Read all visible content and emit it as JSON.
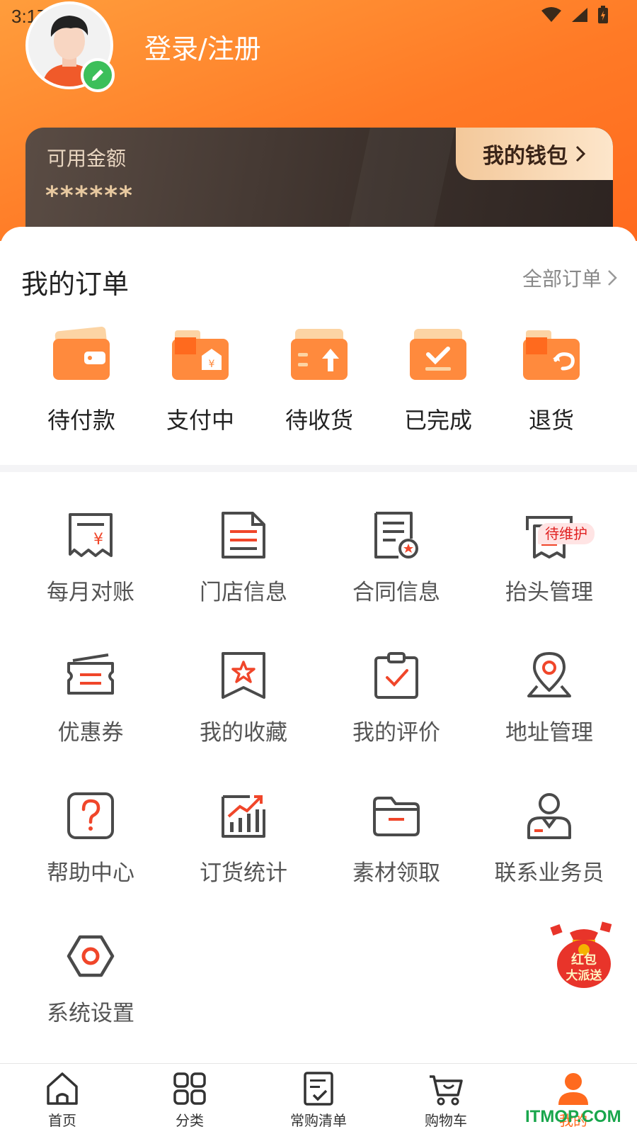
{
  "status_bar": {
    "time": "3:17"
  },
  "profile": {
    "login_text": "登录/注册"
  },
  "wallet": {
    "label": "可用金额",
    "amount": "******",
    "button_label": "我的钱包"
  },
  "orders": {
    "title": "我的订单",
    "all_label": "全部订单",
    "items": [
      {
        "label": "待付款",
        "icon": "wallet-icon"
      },
      {
        "label": "支付中",
        "icon": "payment-folder-icon"
      },
      {
        "label": "待收货",
        "icon": "receive-icon"
      },
      {
        "label": "已完成",
        "icon": "completed-icon"
      },
      {
        "label": "退货",
        "icon": "return-icon"
      }
    ]
  },
  "services": {
    "badge": "待维护",
    "items": [
      {
        "label": "每月对账",
        "icon": "receipt-icon"
      },
      {
        "label": "门店信息",
        "icon": "document-icon"
      },
      {
        "label": "合同信息",
        "icon": "contract-icon"
      },
      {
        "label": "抬头管理",
        "icon": "invoice-title-icon"
      },
      {
        "label": "优惠券",
        "icon": "coupon-icon"
      },
      {
        "label": "我的收藏",
        "icon": "favorite-icon"
      },
      {
        "label": "我的评价",
        "icon": "review-icon"
      },
      {
        "label": "地址管理",
        "icon": "location-icon"
      },
      {
        "label": "帮助中心",
        "icon": "help-icon"
      },
      {
        "label": "订货统计",
        "icon": "stats-icon"
      },
      {
        "label": "素材领取",
        "icon": "folder-icon"
      },
      {
        "label": "联系业务员",
        "icon": "salesperson-icon"
      },
      {
        "label": "系统设置",
        "icon": "settings-icon"
      }
    ]
  },
  "promo": {
    "text_line1": "红包",
    "text_line2": "大派送"
  },
  "tabbar": {
    "items": [
      {
        "label": "首页",
        "icon": "home-icon"
      },
      {
        "label": "分类",
        "icon": "category-icon"
      },
      {
        "label": "常购清单",
        "icon": "list-icon"
      },
      {
        "label": "购物车",
        "icon": "cart-icon"
      },
      {
        "label": "我的",
        "icon": "user-icon"
      }
    ]
  },
  "watermark": "ITMOP.COM",
  "colors": {
    "accent": "#ff7a26",
    "icon_gray": "#4a4a4a",
    "icon_red": "#f0462a",
    "badge_red": "#e02020"
  }
}
